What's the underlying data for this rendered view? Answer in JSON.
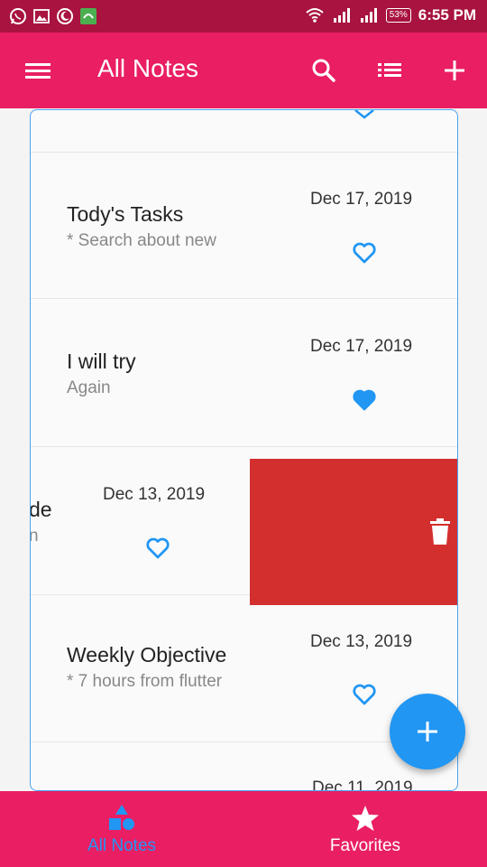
{
  "status_bar": {
    "time": "6:55 PM",
    "battery": "53%",
    "icons": [
      "whatsapp-icon",
      "gallery-icon",
      "moon-icon",
      "app-icon",
      "wifi-icon",
      "signal-icon",
      "signal-icon"
    ]
  },
  "app_bar": {
    "title": "All Notes",
    "actions": [
      "search-icon",
      "list-icon",
      "add-icon"
    ]
  },
  "notes": [
    {
      "title": "Tody's Tasks",
      "subtitle": "* Search about new",
      "date": "Dec 17, 2019",
      "favorite": false
    },
    {
      "title": "I will try",
      "subtitle": "Again",
      "date": "Dec 17, 2019",
      "favorite": true
    },
    {
      "title": "de",
      "subtitle": "n",
      "date": "Dec 13, 2019",
      "favorite": false
    },
    {
      "title": "Weekly Objective",
      "subtitle": "* 7 hours from flutter",
      "date": "Dec 13, 2019",
      "favorite": false
    },
    {
      "title": "",
      "subtitle": "",
      "date": "Dec 11, 2019",
      "favorite": false
    }
  ],
  "bottom_nav": {
    "items": [
      {
        "label": "All Notes",
        "active": true,
        "icon": "shapes-icon"
      },
      {
        "label": "Favorites",
        "active": false,
        "icon": "star-icon"
      }
    ]
  },
  "colors": {
    "primary": "#e91e63",
    "status_bar": "#a8133f",
    "accent": "#2196f3",
    "delete": "#d32f2f"
  }
}
